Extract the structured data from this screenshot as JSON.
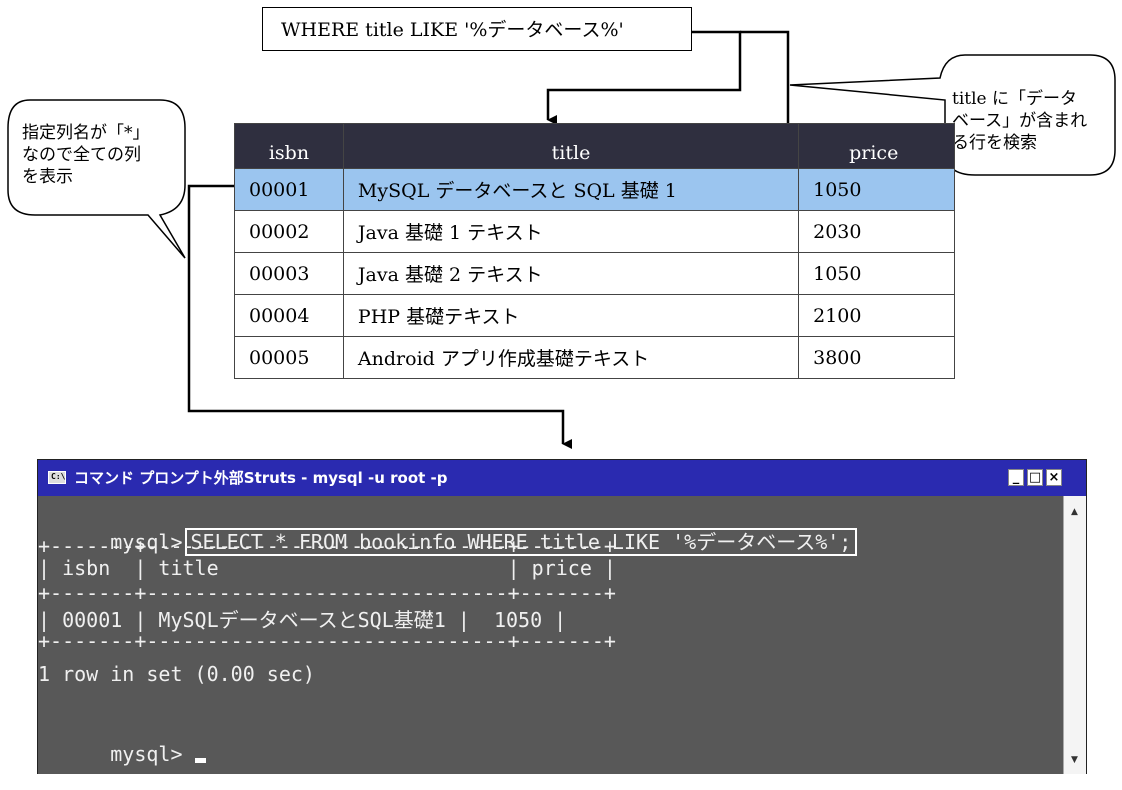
{
  "annotations": {
    "query_clause": "WHERE title LIKE '%データベース%'",
    "left_callout": [
      "指定列名が「*」",
      "なので全ての列",
      "を表示"
    ],
    "right_callout": [
      "title に「データ",
      "ベース」が含まれ",
      "る行を検索"
    ]
  },
  "table": {
    "headers": [
      "isbn",
      "title",
      "price"
    ],
    "rows": [
      [
        "00001",
        "MySQL データベースと SQL 基礎 1",
        "1050"
      ],
      [
        "00002",
        "Java 基礎 1 テキスト",
        "2030"
      ],
      [
        "00003",
        "Java 基礎 2 テキスト",
        "1050"
      ],
      [
        "00004",
        "PHP 基礎テキスト",
        "2100"
      ],
      [
        "00005",
        "Android アプリ作成基礎テキスト",
        "3800"
      ]
    ],
    "highlight_color": "#9bc5ef",
    "header_color": "#2f2f3f"
  },
  "terminal": {
    "title": "コマンド プロンプト外部Struts - mysql -u root -p",
    "icon": "console-icon",
    "prompt": "mysql>",
    "command": "SELECT * FROM bookinfo WHERE title LIKE '%データベース%';",
    "lines": [
      "+-------+------------------------------+-------+",
      "| isbn  | title                        | price |",
      "+-------+------------------------------+-------+",
      "| 00001 | MySQLデータベースとSQL基礎1 |  1050 |",
      "+-------+------------------------------+-------+",
      "1 row in set (0.00 sec)"
    ],
    "prompt2": "mysql>",
    "cursor": "_",
    "buttons": {
      "minimize": "_",
      "maximize": "□",
      "close": "×"
    },
    "title_color": "#2a2ab0",
    "bg_color": "#585858"
  }
}
